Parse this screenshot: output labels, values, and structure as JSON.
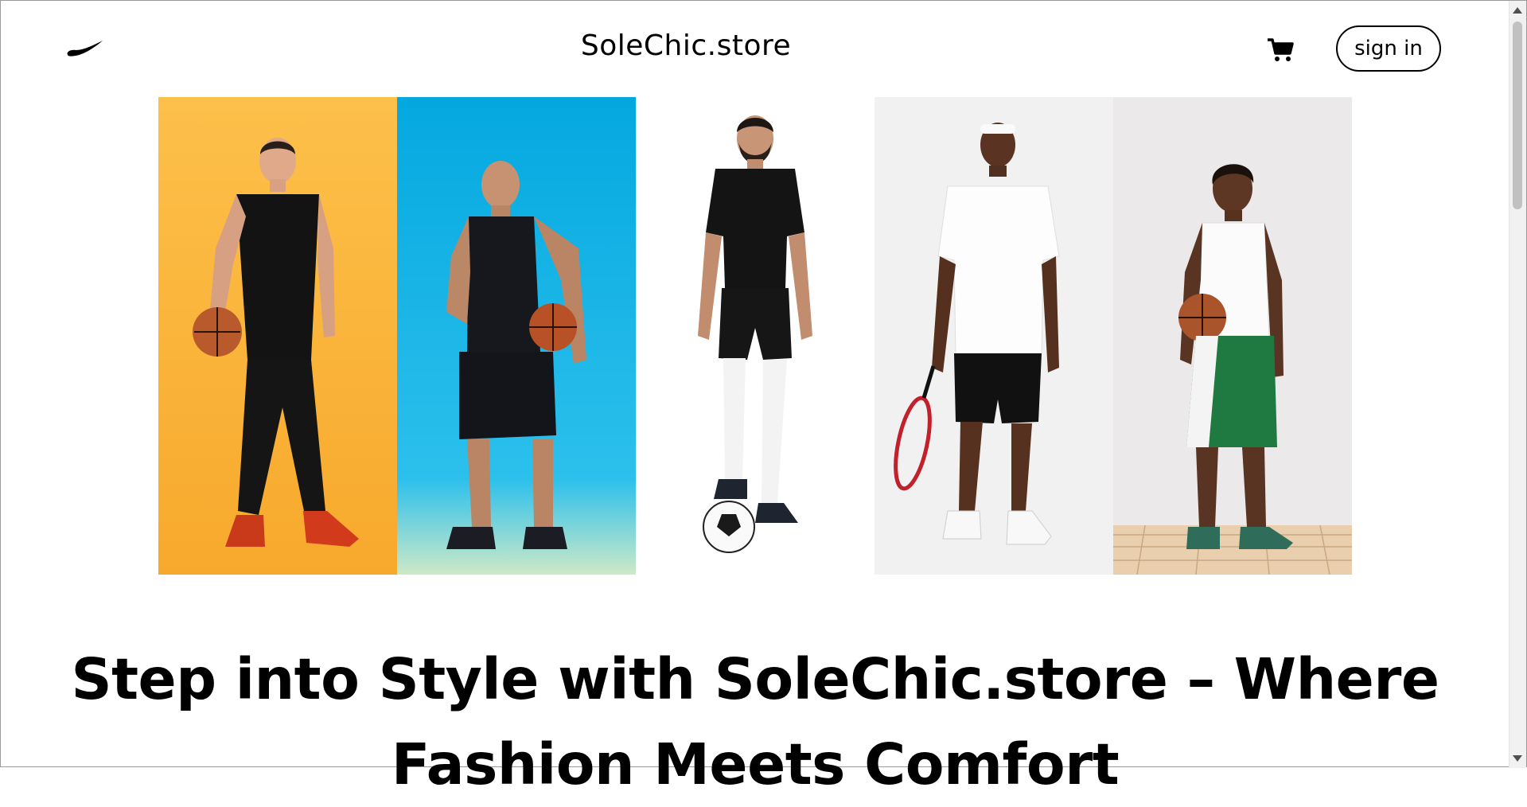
{
  "header": {
    "logo_icon": "swoosh-icon",
    "site_title": "SoleChic.store",
    "cart_icon": "cart-icon",
    "signin_label": "sign in"
  },
  "gallery": {
    "panels": [
      {
        "name": "basketball-player-orange",
        "background": "#fbb33f"
      },
      {
        "name": "basketball-player-blue",
        "background": "#10b4e6"
      },
      {
        "name": "soccer-player-white",
        "background": "#ffffff"
      },
      {
        "name": "tennis-player-grey",
        "background": "#f1f1f1"
      },
      {
        "name": "basketball-player-studio",
        "background": "#ebe9ea"
      }
    ]
  },
  "hero": {
    "headline_line1": "Step into Style with SoleChic.store – Where",
    "headline_line2": "Fashion Meets Comfort"
  }
}
